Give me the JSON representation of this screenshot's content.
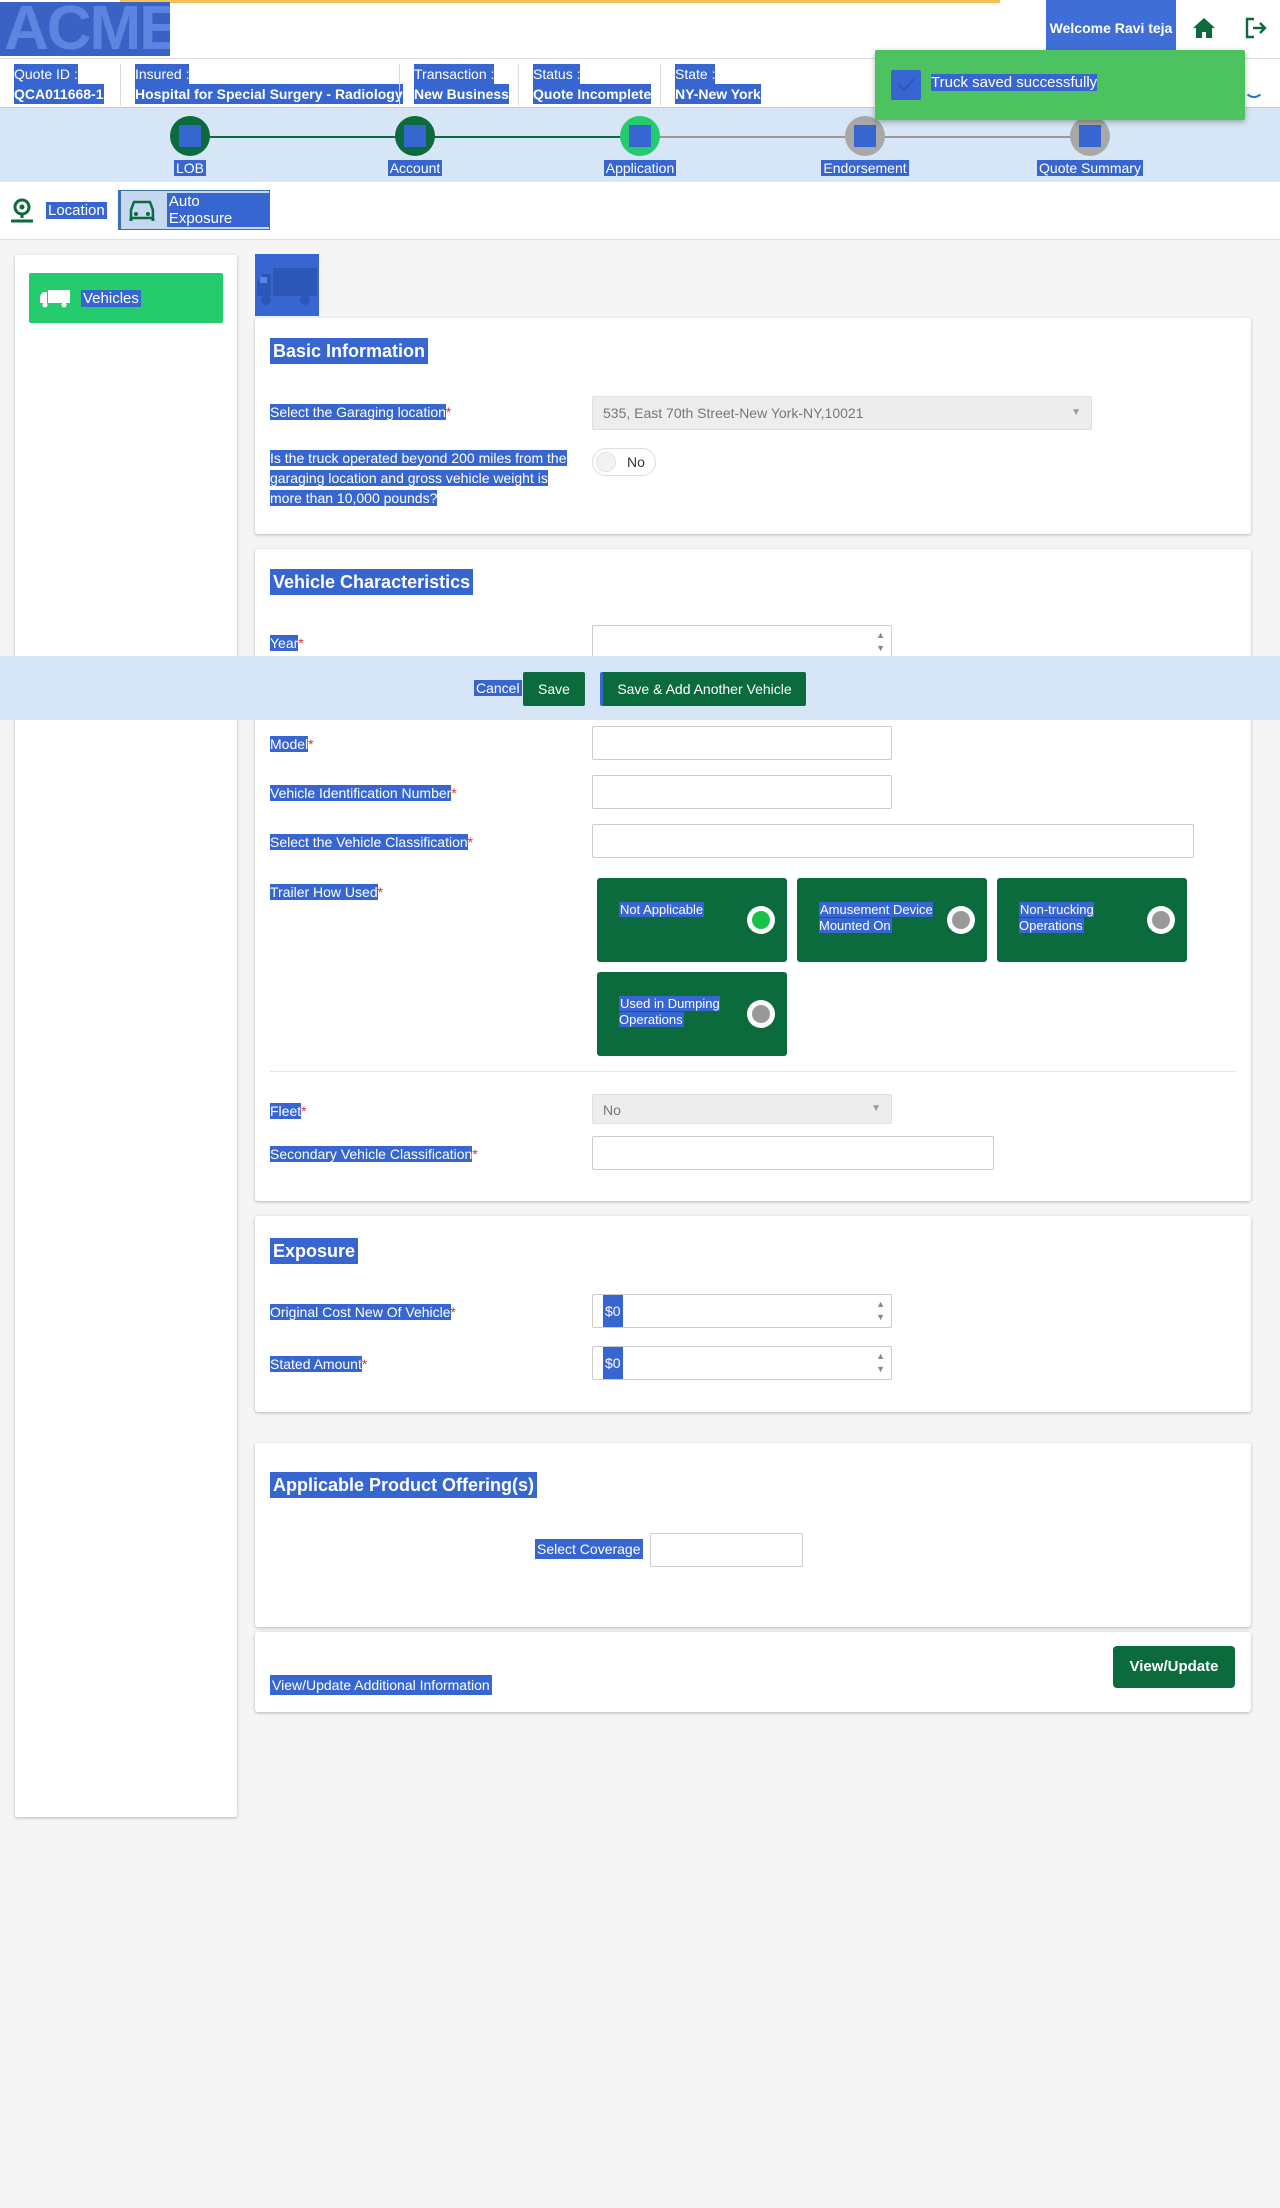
{
  "header": {
    "logo": "ACME",
    "welcome": "Welcome Ravi teja",
    "home_icon": "home-icon",
    "logout_icon": "logout-icon"
  },
  "info": {
    "quote_id_label": "Quote ID :",
    "quote_id": "QCA011668-1",
    "insured_label": "Insured :",
    "insured": "Hospital for Special Surgery - Radiology",
    "transaction_label": "Transaction :",
    "transaction": "New Business",
    "status_label": "Status :",
    "status": "Quote Incomplete",
    "state_label": "State :",
    "state": "NY-New York"
  },
  "toast": {
    "message": "Truck saved successfully"
  },
  "steps": [
    {
      "label": "LOB",
      "state": "done"
    },
    {
      "label": "Account",
      "state": "done"
    },
    {
      "label": "Application",
      "state": "current"
    },
    {
      "label": "Endorsement",
      "state": "pending"
    },
    {
      "label": "Quote Summary",
      "state": "pending"
    }
  ],
  "subtabs": {
    "location": "Location",
    "auto_exposure": "Auto Exposure"
  },
  "sidebar": {
    "vehicles": "Vehicles"
  },
  "basic_info": {
    "title": "Basic Information",
    "garaging_label": "Select the Garaging location",
    "garaging_value": "535, East 70th Street-New York-NY,10021",
    "beyond_label": "Is the truck operated beyond 200 miles from the garaging location and gross vehicle weight is more than 10,000 pounds?",
    "beyond_value": "No"
  },
  "vehicle_chars": {
    "title": "Vehicle Characteristics",
    "year_label": "Year",
    "model_label": "Model",
    "vin_label": "Vehicle Identification Number",
    "classification_label": "Select the Vehicle Classification",
    "trailer_label": "Trailer How Used",
    "trailer_options": [
      {
        "label": "Not Applicable",
        "selected": true
      },
      {
        "label": "Amusement Device Mounted On",
        "selected": false
      },
      {
        "label": "Non-trucking Operations",
        "selected": false
      },
      {
        "label": "Used in Dumping Operations",
        "selected": false
      }
    ],
    "fleet_label": "Fleet",
    "fleet_value": "No",
    "secondary_label": "Secondary Vehicle Classification"
  },
  "actions": {
    "cancel": "Cancel",
    "save": "Save",
    "save_add": "Save & Add Another Vehicle"
  },
  "exposure": {
    "title": "Exposure",
    "cost_label": "Original Cost New Of Vehicle",
    "cost_prefix": "$0",
    "stated_label": "Stated Amount",
    "stated_prefix": "$0"
  },
  "products": {
    "title": "Applicable Product Offering(s)",
    "coverage_label": "Select Coverage"
  },
  "additional": {
    "label": "View/Update Additional Information",
    "button": "View/Update"
  },
  "colors": {
    "primary_green": "#0b6b3d",
    "accent_green": "#25cc6e",
    "selection_blue": "#3866d0",
    "step_bar": "#d6e6f6"
  }
}
